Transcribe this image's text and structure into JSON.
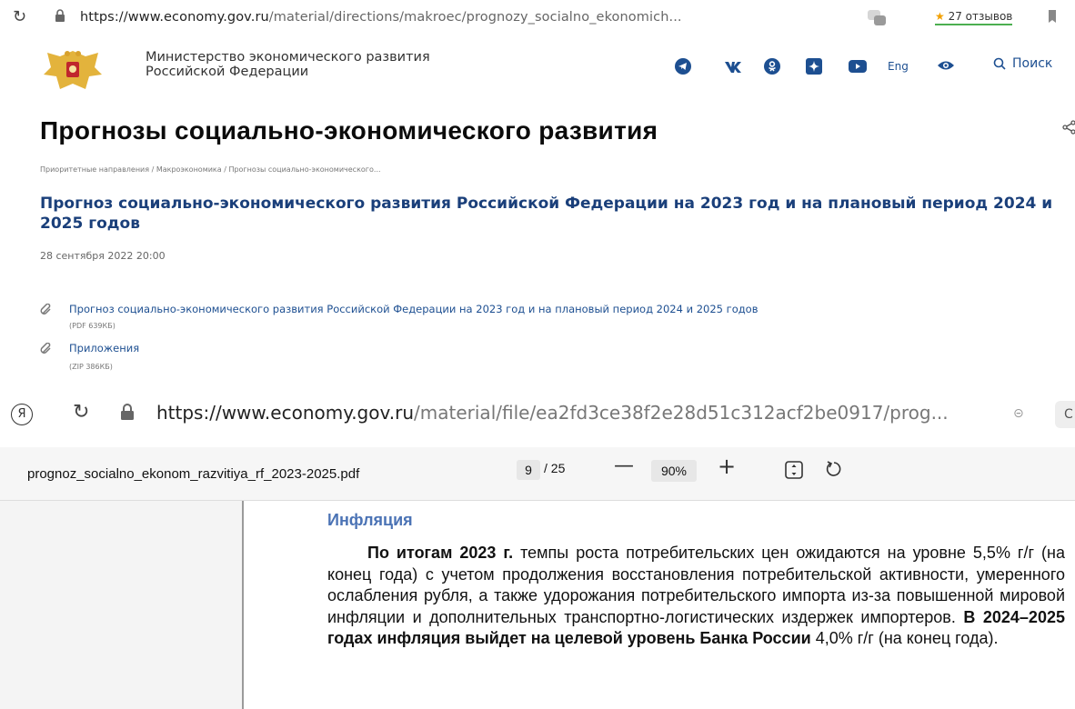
{
  "browser_top": {
    "url_host": "https://www.economy.gov.ru",
    "url_path": "/material/directions/makroec/prognozy_socialno_ekonomich...",
    "reviews": "27 отзывов"
  },
  "site": {
    "ministry_line1": "Министерство экономического развития",
    "ministry_line2": "Российской Федерации",
    "lang": "Eng",
    "search": "Поиск"
  },
  "article": {
    "page_title": "Прогнозы социально-экономического развития",
    "breadcrumb": "Приоритетные направления / Макроэкономика / Прогнозы социально-экономического...",
    "doc_title": "Прогноз социально-экономического развития Российской Федерации на 2023 год и на плановый период 2024 и 2025 годов",
    "date": "28 сентября 2022 20:00",
    "attachments": [
      {
        "label": "Прогноз социально-экономического развития Российской Федерации на 2023 год и на плановый период 2024 и 2025 годов",
        "meta": "(PDF 639КБ)"
      },
      {
        "label": "Приложения",
        "meta": "(ZIP 386КБ)"
      }
    ]
  },
  "browser_pdf": {
    "url_host": "https://www.economy.gov.ru",
    "url_path": "/material/file/ea2fd3ce38f2e28d51c312acf2be0917/prog...",
    "ya": "Я"
  },
  "pdf": {
    "filename": "prognoz_socialno_ekonom_razvitiya_rf_2023-2025.pdf",
    "page": "9",
    "total": "/ 25",
    "zoom": "90%",
    "heading": "Инфляция",
    "p_bold1": "По итогам 2023 г.",
    "p_text1": " темпы роста потребительских цен ожидаются на уровне 5,5% г/г (на конец года) с учетом продолжения восстановления потребительской активности, умеренного ослабления рубля, а также удорожания потребительского импорта из-за повышенной мировой инфляции и дополнительных транспортно-логистических издержек импортеров. ",
    "p_bold2": "В 2024–2025 годах инфляция выйдет на целевой уровень Банка России",
    "p_text2": " 4,0% г/г (на конец года)."
  },
  "colors": {
    "link": "#1d4f91",
    "title_blue": "#1a3f7a",
    "pdf_heading": "#4b73b5"
  }
}
